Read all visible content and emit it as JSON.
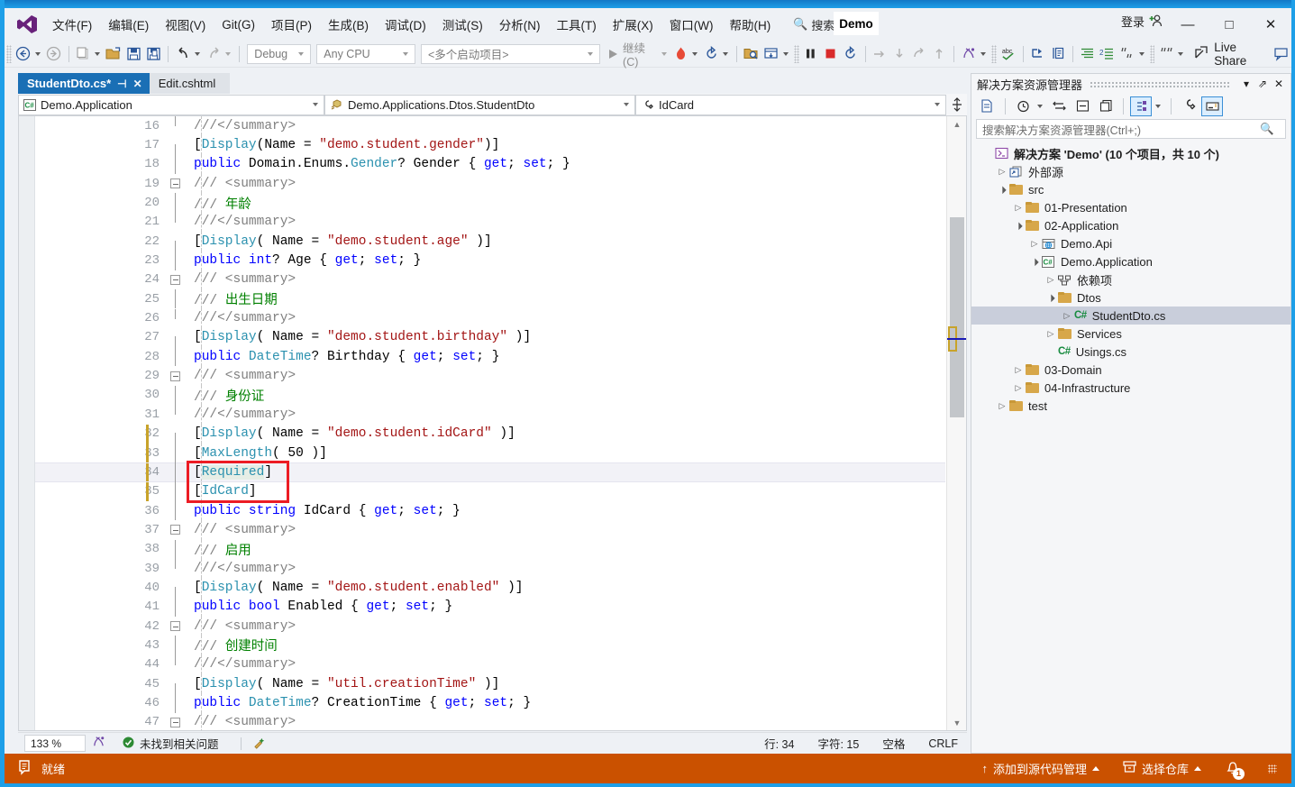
{
  "window": {
    "app_title": "Demo",
    "login_label": "登录",
    "minimize": "—",
    "maximize": "□",
    "close": "✕"
  },
  "menu": {
    "items": [
      "文件(F)",
      "编辑(E)",
      "视图(V)",
      "Git(G)",
      "项目(P)",
      "生成(B)",
      "调试(D)",
      "测试(S)",
      "分析(N)",
      "工具(T)",
      "扩展(X)",
      "窗口(W)",
      "帮助(H)"
    ],
    "search_label": "搜索"
  },
  "toolbar": {
    "configuration": "Debug",
    "platform": "Any CPU",
    "startup_project": "<多个启动项目>",
    "run_label": "继续(C)",
    "live_share": "Live Share"
  },
  "tabs": [
    {
      "label": "StudentDto.cs*",
      "active": true,
      "pinnable": true,
      "closable": true
    },
    {
      "label": "Edit.cshtml",
      "active": false
    }
  ],
  "navbar": {
    "project": "Demo.Application",
    "type": "Demo.Applications.Dtos.StudentDto",
    "member": "IdCard"
  },
  "editor": {
    "cursor_line": 34,
    "annotation": {
      "color": "#ec1c24",
      "covers_lines": [
        34,
        35
      ]
    },
    "lines": [
      {
        "n": 16,
        "outline": "end",
        "tokens": [
          {
            "t": "///</summary>",
            "c": "t-cmt"
          }
        ]
      },
      {
        "n": 17,
        "outline": "top",
        "tokens": [
          {
            "t": "[",
            "c": "t-plain"
          },
          {
            "t": "Display",
            "c": "t-attr"
          },
          {
            "t": "(Name = ",
            "c": "t-plain"
          },
          {
            "t": "\"demo.student.gender\"",
            "c": "t-str"
          },
          {
            "t": ")]",
            "c": "t-plain"
          }
        ]
      },
      {
        "n": 18,
        "outline": "mid",
        "tokens": [
          {
            "t": "public ",
            "c": "t-kw"
          },
          {
            "t": "Domain.Enums.",
            "c": "t-plain"
          },
          {
            "t": "Gender",
            "c": "t-type"
          },
          {
            "t": "? Gender { ",
            "c": "t-plain"
          },
          {
            "t": "get",
            "c": "t-kw"
          },
          {
            "t": "; ",
            "c": "t-plain"
          },
          {
            "t": "set",
            "c": "t-kw"
          },
          {
            "t": "; }",
            "c": "t-plain"
          }
        ]
      },
      {
        "n": 19,
        "outline": "collapse",
        "tokens": [
          {
            "t": "/// <summary>",
            "c": "t-cmt"
          }
        ]
      },
      {
        "n": 20,
        "outline": "mid",
        "tokens": [
          {
            "t": "/// ",
            "c": "t-cmt"
          },
          {
            "t": "年龄",
            "c": "t-green"
          }
        ]
      },
      {
        "n": 21,
        "outline": "end",
        "tokens": [
          {
            "t": "///</summary>",
            "c": "t-cmt"
          }
        ]
      },
      {
        "n": 22,
        "outline": "top",
        "tokens": [
          {
            "t": "[",
            "c": "t-plain"
          },
          {
            "t": "Display",
            "c": "t-attr"
          },
          {
            "t": "( Name = ",
            "c": "t-plain"
          },
          {
            "t": "\"demo.student.age\"",
            "c": "t-str"
          },
          {
            "t": " )]",
            "c": "t-plain"
          }
        ]
      },
      {
        "n": 23,
        "outline": "mid",
        "tokens": [
          {
            "t": "public ",
            "c": "t-kw"
          },
          {
            "t": "int",
            "c": "t-kw"
          },
          {
            "t": "? Age { ",
            "c": "t-plain"
          },
          {
            "t": "get",
            "c": "t-kw"
          },
          {
            "t": "; ",
            "c": "t-plain"
          },
          {
            "t": "set",
            "c": "t-kw"
          },
          {
            "t": "; }",
            "c": "t-plain"
          }
        ]
      },
      {
        "n": 24,
        "outline": "collapse",
        "tokens": [
          {
            "t": "/// <summary>",
            "c": "t-cmt"
          }
        ]
      },
      {
        "n": 25,
        "outline": "mid",
        "tokens": [
          {
            "t": "/// ",
            "c": "t-cmt"
          },
          {
            "t": "出生日期",
            "c": "t-green"
          }
        ]
      },
      {
        "n": 26,
        "outline": "end",
        "tokens": [
          {
            "t": "///</summary>",
            "c": "t-cmt"
          }
        ]
      },
      {
        "n": 27,
        "outline": "top",
        "tokens": [
          {
            "t": "[",
            "c": "t-plain"
          },
          {
            "t": "Display",
            "c": "t-attr"
          },
          {
            "t": "( Name = ",
            "c": "t-plain"
          },
          {
            "t": "\"demo.student.birthday\"",
            "c": "t-str"
          },
          {
            "t": " )]",
            "c": "t-plain"
          }
        ]
      },
      {
        "n": 28,
        "outline": "mid",
        "tokens": [
          {
            "t": "public ",
            "c": "t-kw"
          },
          {
            "t": "DateTime",
            "c": "t-type"
          },
          {
            "t": "? Birthday { ",
            "c": "t-plain"
          },
          {
            "t": "get",
            "c": "t-kw"
          },
          {
            "t": "; ",
            "c": "t-plain"
          },
          {
            "t": "set",
            "c": "t-kw"
          },
          {
            "t": "; }",
            "c": "t-plain"
          }
        ]
      },
      {
        "n": 29,
        "outline": "collapse",
        "tokens": [
          {
            "t": "/// <summary>",
            "c": "t-cmt"
          }
        ]
      },
      {
        "n": 30,
        "outline": "mid",
        "tokens": [
          {
            "t": "/// ",
            "c": "t-cmt"
          },
          {
            "t": "身份证",
            "c": "t-green"
          }
        ]
      },
      {
        "n": 31,
        "outline": "end",
        "tokens": [
          {
            "t": "///</summary>",
            "c": "t-cmt"
          }
        ]
      },
      {
        "n": 32,
        "outline": "top",
        "changed": true,
        "tokens": [
          {
            "t": "[",
            "c": "t-plain"
          },
          {
            "t": "Display",
            "c": "t-attr"
          },
          {
            "t": "( Name = ",
            "c": "t-plain"
          },
          {
            "t": "\"demo.student.idCard\"",
            "c": "t-str"
          },
          {
            "t": " )]",
            "c": "t-plain"
          }
        ]
      },
      {
        "n": 33,
        "outline": "mid",
        "changed": true,
        "tokens": [
          {
            "t": "[",
            "c": "t-plain"
          },
          {
            "t": "MaxLength",
            "c": "t-attr"
          },
          {
            "t": "( 50 )]",
            "c": "t-plain"
          }
        ]
      },
      {
        "n": 34,
        "outline": "mid",
        "changed": true,
        "cursor": true,
        "tokens": [
          {
            "t": "[",
            "c": "t-plain"
          },
          {
            "t": "Required",
            "c": "t-attr hl-ref"
          },
          {
            "t": "]",
            "c": "t-plain"
          }
        ]
      },
      {
        "n": 35,
        "outline": "mid",
        "changed": true,
        "tokens": [
          {
            "t": "[",
            "c": "t-plain"
          },
          {
            "t": "IdCard",
            "c": "t-attr"
          },
          {
            "t": "]",
            "c": "t-plain"
          }
        ]
      },
      {
        "n": 36,
        "outline": "mid",
        "tokens": [
          {
            "t": "public ",
            "c": "t-kw"
          },
          {
            "t": "string",
            "c": "t-kw"
          },
          {
            "t": " IdCard { ",
            "c": "t-plain"
          },
          {
            "t": "get",
            "c": "t-kw"
          },
          {
            "t": "; ",
            "c": "t-plain"
          },
          {
            "t": "set",
            "c": "t-kw"
          },
          {
            "t": "; }",
            "c": "t-plain"
          }
        ]
      },
      {
        "n": 37,
        "outline": "collapse",
        "tokens": [
          {
            "t": "/// <summary>",
            "c": "t-cmt"
          }
        ]
      },
      {
        "n": 38,
        "outline": "mid",
        "tokens": [
          {
            "t": "/// ",
            "c": "t-cmt"
          },
          {
            "t": "启用",
            "c": "t-green"
          }
        ]
      },
      {
        "n": 39,
        "outline": "end",
        "tokens": [
          {
            "t": "///</summary>",
            "c": "t-cmt"
          }
        ]
      },
      {
        "n": 40,
        "outline": "top",
        "tokens": [
          {
            "t": "[",
            "c": "t-plain"
          },
          {
            "t": "Display",
            "c": "t-attr"
          },
          {
            "t": "( Name = ",
            "c": "t-plain"
          },
          {
            "t": "\"demo.student.enabled\"",
            "c": "t-str"
          },
          {
            "t": " )]",
            "c": "t-plain"
          }
        ]
      },
      {
        "n": 41,
        "outline": "mid",
        "tokens": [
          {
            "t": "public ",
            "c": "t-kw"
          },
          {
            "t": "bool",
            "c": "t-kw"
          },
          {
            "t": " Enabled { ",
            "c": "t-plain"
          },
          {
            "t": "get",
            "c": "t-kw"
          },
          {
            "t": "; ",
            "c": "t-plain"
          },
          {
            "t": "set",
            "c": "t-kw"
          },
          {
            "t": "; }",
            "c": "t-plain"
          }
        ]
      },
      {
        "n": 42,
        "outline": "collapse",
        "tokens": [
          {
            "t": "/// <summary>",
            "c": "t-cmt"
          }
        ]
      },
      {
        "n": 43,
        "outline": "mid",
        "tokens": [
          {
            "t": "/// ",
            "c": "t-cmt"
          },
          {
            "t": "创建时间",
            "c": "t-green"
          }
        ]
      },
      {
        "n": 44,
        "outline": "end",
        "tokens": [
          {
            "t": "///</summary>",
            "c": "t-cmt"
          }
        ]
      },
      {
        "n": 45,
        "outline": "top",
        "tokens": [
          {
            "t": "[",
            "c": "t-plain"
          },
          {
            "t": "Display",
            "c": "t-attr"
          },
          {
            "t": "( Name = ",
            "c": "t-plain"
          },
          {
            "t": "\"util.creationTime\"",
            "c": "t-str"
          },
          {
            "t": " )]",
            "c": "t-plain"
          }
        ]
      },
      {
        "n": 46,
        "outline": "mid",
        "tokens": [
          {
            "t": "public ",
            "c": "t-kw"
          },
          {
            "t": "DateTime",
            "c": "t-type"
          },
          {
            "t": "? CreationTime { ",
            "c": "t-plain"
          },
          {
            "t": "get",
            "c": "t-kw"
          },
          {
            "t": "; ",
            "c": "t-plain"
          },
          {
            "t": "set",
            "c": "t-kw"
          },
          {
            "t": "; }",
            "c": "t-plain"
          }
        ]
      },
      {
        "n": 47,
        "outline": "collapse",
        "tokens": [
          {
            "t": "/// <summary>",
            "c": "t-cmt"
          }
        ]
      }
    ]
  },
  "editor_footer": {
    "zoom": "133 %",
    "issues": "未找到相关问题",
    "line_label": "行: 34",
    "char_label": "字符: 15",
    "spaces": "空格",
    "eol": "CRLF"
  },
  "solution_explorer": {
    "title": "解决方案资源管理器",
    "search_placeholder": "搜索解决方案资源管理器(Ctrl+;)",
    "root": "解决方案 'Demo' (10 个项目，共 10 个)",
    "tree": [
      {
        "label": "外部源",
        "depth": 1,
        "state": "collapsed",
        "icon": "external-source"
      },
      {
        "label": "src",
        "depth": 1,
        "state": "expanded",
        "icon": "folder"
      },
      {
        "label": "01-Presentation",
        "depth": 2,
        "state": "collapsed",
        "icon": "folder"
      },
      {
        "label": "02-Application",
        "depth": 2,
        "state": "expanded",
        "icon": "folder"
      },
      {
        "label": "Demo.Api",
        "depth": 3,
        "state": "collapsed",
        "icon": "web-project"
      },
      {
        "label": "Demo.Application",
        "depth": 3,
        "state": "expanded",
        "icon": "cs-project"
      },
      {
        "label": "依赖项",
        "depth": 4,
        "state": "collapsed",
        "icon": "dependencies"
      },
      {
        "label": "Dtos",
        "depth": 4,
        "state": "expanded",
        "icon": "folder"
      },
      {
        "label": "StudentDto.cs",
        "depth": 5,
        "state": "collapsed",
        "icon": "cs-file",
        "selected": true
      },
      {
        "label": "Services",
        "depth": 4,
        "state": "collapsed",
        "icon": "folder"
      },
      {
        "label": "Usings.cs",
        "depth": 4,
        "state": "leaf",
        "icon": "cs-file"
      },
      {
        "label": "03-Domain",
        "depth": 2,
        "state": "collapsed",
        "icon": "folder"
      },
      {
        "label": "04-Infrastructure",
        "depth": 2,
        "state": "collapsed",
        "icon": "folder"
      },
      {
        "label": "test",
        "depth": 1,
        "state": "collapsed",
        "icon": "folder"
      }
    ]
  },
  "statusbar": {
    "ready": "就绪",
    "source_control": "添加到源代码管理",
    "select_repo": "选择仓库",
    "notification_count": "1",
    "bg_color": "#ca5100"
  }
}
